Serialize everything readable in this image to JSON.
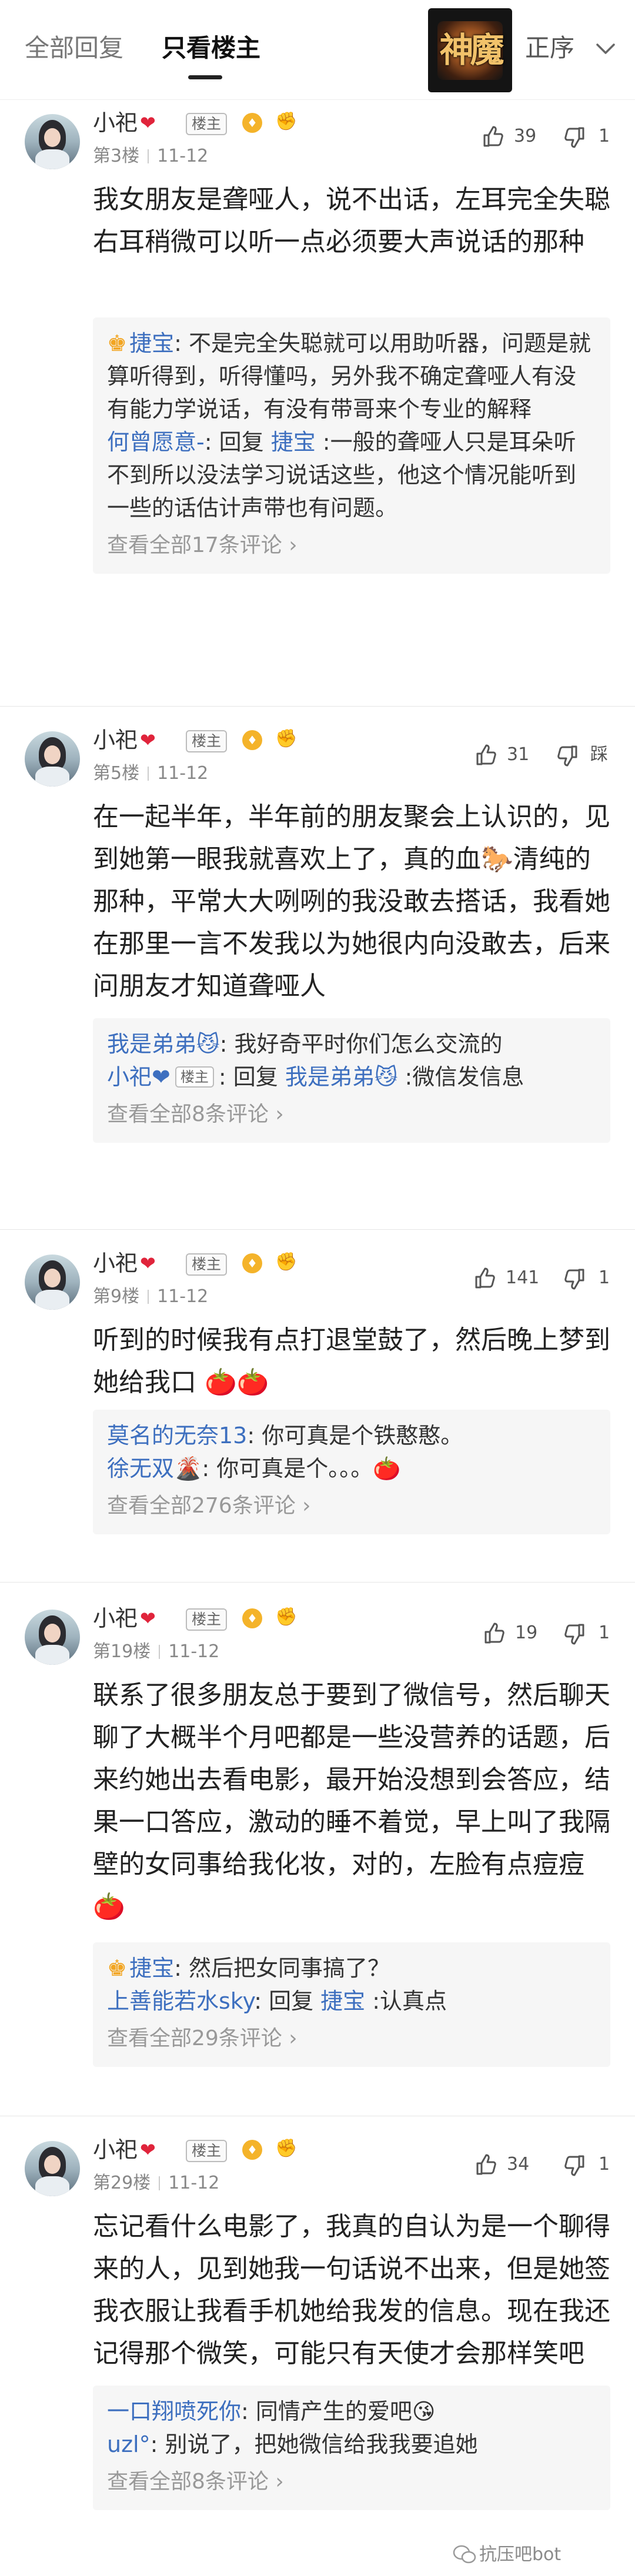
{
  "header": {
    "tab_all": "全部回复",
    "tab_op": "只看楼主",
    "game_logo_text": "神魔",
    "sort_label": "正序"
  },
  "op_name": "小祀",
  "op_badge": "楼主",
  "comments": [
    {
      "floor": "第3楼",
      "date": "11-12",
      "likes": "39",
      "dislikes": "1",
      "body": "我女朋友是聋哑人，说不出话，左耳完全失聪右耳稍微可以听一点必须要大声说话的那种",
      "replies": [
        {
          "name": "捷宝",
          "text": ": 不是完全失聪就可以用助听器，问题是就算听得到，听得懂吗，另外我不确定聋哑人有没有能力学说话，有没有带哥来个专业的解释"
        },
        {
          "name": "何曾愿意-",
          "text": ": 回复 ",
          "target": "捷宝",
          "text2": " :一般的聋哑人只是耳朵听不到所以没法学习说话这些，他这个情况能听到一些的话估计声带也有问题。"
        }
      ],
      "view_all": "查看全部17条评论"
    },
    {
      "floor": "第5楼",
      "date": "11-12",
      "likes": "31",
      "dislikes": "踩",
      "body": "在一起半年，半年前的朋友聚会上认识的，见到她第一眼我就喜欢上了，真的血🐎清纯的那种，平常大大咧咧的我没敢去搭话，我看她在那里一言不发我以为她很内向没敢去，后来问朋友才知道聋哑人",
      "replies": [
        {
          "name": "我是弟弟😼",
          "text": ": 我好奇平时你们怎么交流的"
        },
        {
          "name": "小祀❤",
          "op": true,
          "text": ": 回复 ",
          "target": "我是弟弟😼",
          "text2": " :微信发信息"
        }
      ],
      "view_all": "查看全部8条评论"
    },
    {
      "floor": "第9楼",
      "date": "11-12",
      "likes": "141",
      "dislikes": "1",
      "body": "听到的时候我有点打退堂鼓了，然后晚上梦到她给我口 🍅🍅",
      "replies": [
        {
          "name": "莫名的无奈13",
          "text": ": 你可真是个铁憨憨。"
        },
        {
          "name": "徐无双🌋",
          "text": ": 你可真是个。。。🍅"
        }
      ],
      "view_all": "查看全部276条评论"
    },
    {
      "floor": "第19楼",
      "date": "11-12",
      "likes": "19",
      "dislikes": "1",
      "body": "联系了很多朋友总于要到了微信号，然后聊天聊了大概半个月吧都是一些没营养的话题，后来约她出去看电影，最开始没想到会答应，结果一口答应，激动的睡不着觉，早上叫了我隔壁的女同事给我化妆，对的，左脸有点痘痘🍅",
      "replies": [
        {
          "name": "捷宝",
          "text": ": 然后把女同事搞了？"
        },
        {
          "name": "上善能若水sky",
          "text": ": 回复 ",
          "target": "捷宝",
          "text2": " :认真点"
        }
      ],
      "view_all": "查看全部29条评论"
    },
    {
      "floor": "第29楼",
      "date": "11-12",
      "likes": "34",
      "dislikes": "1",
      "body": "忘记看什么电影了，我真的自认为是一个聊得来的人，见到她我一句话说不出来，但是她签我衣服让我看手机她给我发的信息。现在我还记得那个微笑，可能只有天使才会那样笑吧",
      "replies": [
        {
          "name": "一口翔喷死你",
          "text": ": 同情产生的爱吧😘"
        },
        {
          "name": "uzl°",
          "text": ": 别说了，把她微信给我我要追她"
        }
      ],
      "view_all": "查看全部8条评论"
    }
  ],
  "watermark": "抗压吧bot"
}
